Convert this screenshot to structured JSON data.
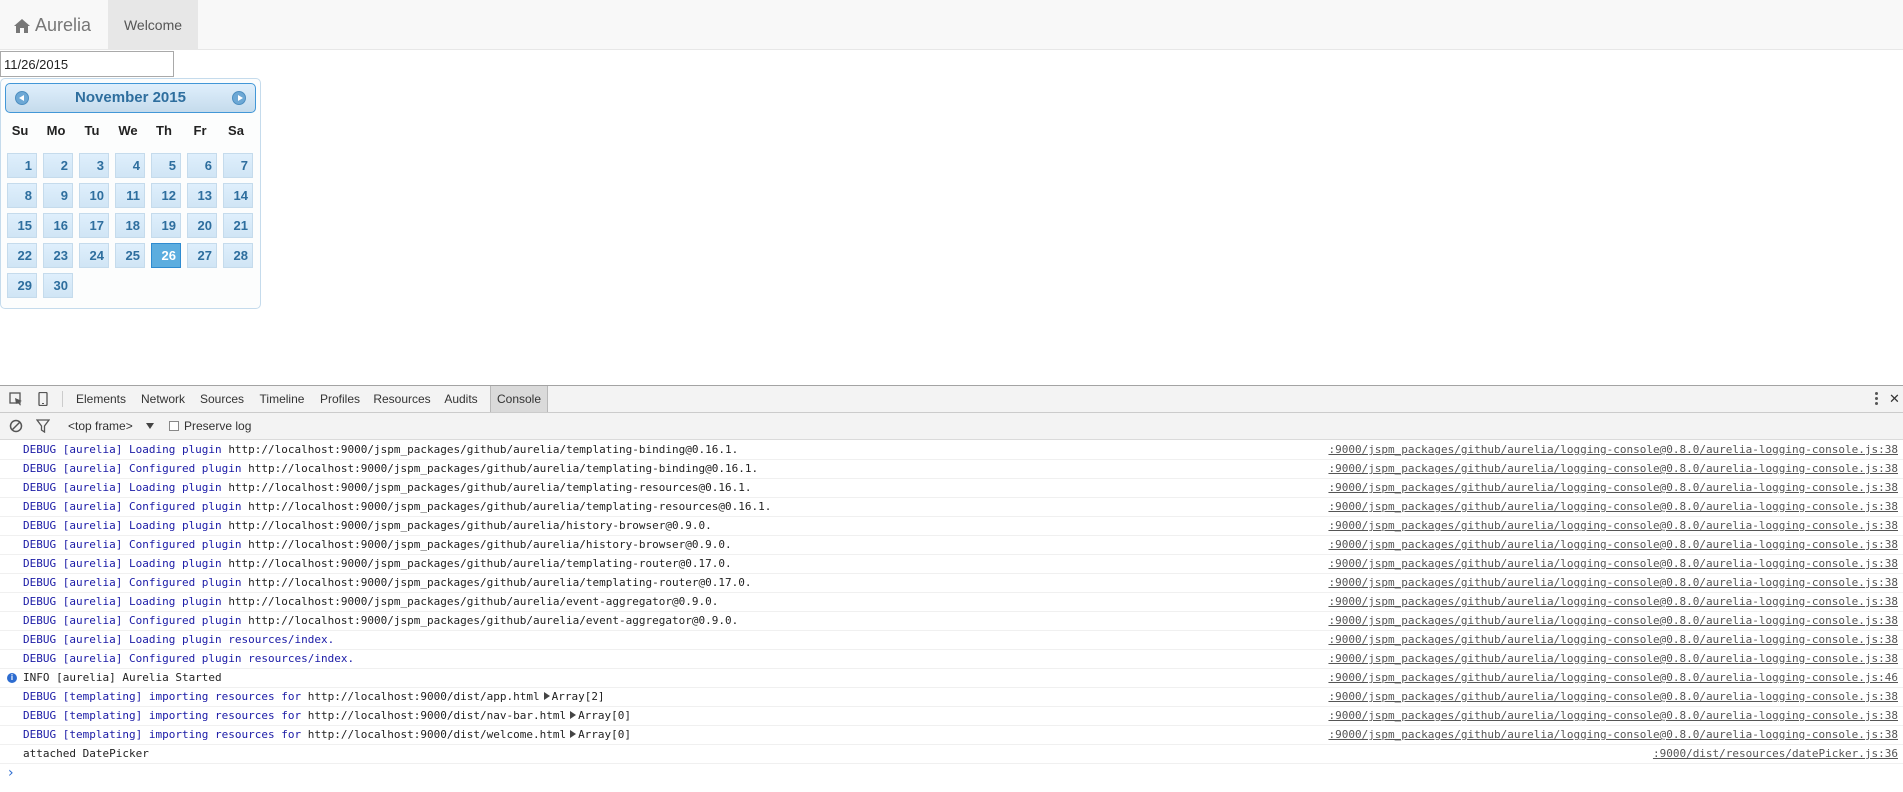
{
  "navbar": {
    "brand": "Aurelia",
    "welcome": "Welcome"
  },
  "date_input": {
    "value": "11/26/2015"
  },
  "datepicker": {
    "title": "November 2015",
    "weekdays": [
      "Su",
      "Mo",
      "Tu",
      "We",
      "Th",
      "Fr",
      "Sa"
    ],
    "days": [
      "1",
      "2",
      "3",
      "4",
      "5",
      "6",
      "7",
      "8",
      "9",
      "10",
      "11",
      "12",
      "13",
      "14",
      "15",
      "16",
      "17",
      "18",
      "19",
      "20",
      "21",
      "22",
      "23",
      "24",
      "25",
      "26",
      "27",
      "28",
      "29",
      "30"
    ],
    "selected_day": "26",
    "start_weekday_index": 0
  },
  "devtools": {
    "tabs": [
      "Elements",
      "Network",
      "Sources",
      "Timeline",
      "Profiles",
      "Resources",
      "Audits",
      "Console"
    ],
    "selected_tab": "Console",
    "frame": "<top frame>",
    "preserve_log_label": "Preserve log"
  },
  "console": {
    "messages": [
      {
        "level": "debug",
        "prefix": "DEBUG [aurelia] Loading plugin ",
        "url": "http://localhost:9000/jspm_packages/github/aurelia/templating-binding@0.16.1.",
        "suffix": "",
        "source": ":9000/jspm_packages/github/aurelia/logging-console@0.8.0/aurelia-logging-console.js:38"
      },
      {
        "level": "debug",
        "prefix": "DEBUG [aurelia] Configured plugin ",
        "url": "http://localhost:9000/jspm_packages/github/aurelia/templating-binding@0.16.1.",
        "suffix": "",
        "source": ":9000/jspm_packages/github/aurelia/logging-console@0.8.0/aurelia-logging-console.js:38"
      },
      {
        "level": "debug",
        "prefix": "DEBUG [aurelia] Loading plugin ",
        "url": "http://localhost:9000/jspm_packages/github/aurelia/templating-resources@0.16.1.",
        "suffix": "",
        "source": ":9000/jspm_packages/github/aurelia/logging-console@0.8.0/aurelia-logging-console.js:38"
      },
      {
        "level": "debug",
        "prefix": "DEBUG [aurelia] Configured plugin ",
        "url": "http://localhost:9000/jspm_packages/github/aurelia/templating-resources@0.16.1.",
        "suffix": "",
        "source": ":9000/jspm_packages/github/aurelia/logging-console@0.8.0/aurelia-logging-console.js:38"
      },
      {
        "level": "debug",
        "prefix": "DEBUG [aurelia] Loading plugin ",
        "url": "http://localhost:9000/jspm_packages/github/aurelia/history-browser@0.9.0.",
        "suffix": "",
        "source": ":9000/jspm_packages/github/aurelia/logging-console@0.8.0/aurelia-logging-console.js:38"
      },
      {
        "level": "debug",
        "prefix": "DEBUG [aurelia] Configured plugin ",
        "url": "http://localhost:9000/jspm_packages/github/aurelia/history-browser@0.9.0.",
        "suffix": "",
        "source": ":9000/jspm_packages/github/aurelia/logging-console@0.8.0/aurelia-logging-console.js:38"
      },
      {
        "level": "debug",
        "prefix": "DEBUG [aurelia] Loading plugin ",
        "url": "http://localhost:9000/jspm_packages/github/aurelia/templating-router@0.17.0.",
        "suffix": "",
        "source": ":9000/jspm_packages/github/aurelia/logging-console@0.8.0/aurelia-logging-console.js:38"
      },
      {
        "level": "debug",
        "prefix": "DEBUG [aurelia] Configured plugin ",
        "url": "http://localhost:9000/jspm_packages/github/aurelia/templating-router@0.17.0.",
        "suffix": "",
        "source": ":9000/jspm_packages/github/aurelia/logging-console@0.8.0/aurelia-logging-console.js:38"
      },
      {
        "level": "debug",
        "prefix": "DEBUG [aurelia] Loading plugin ",
        "url": "http://localhost:9000/jspm_packages/github/aurelia/event-aggregator@0.9.0.",
        "suffix": "",
        "source": ":9000/jspm_packages/github/aurelia/logging-console@0.8.0/aurelia-logging-console.js:38"
      },
      {
        "level": "debug",
        "prefix": "DEBUG [aurelia] Configured plugin ",
        "url": "http://localhost:9000/jspm_packages/github/aurelia/event-aggregator@0.9.0.",
        "suffix": "",
        "source": ":9000/jspm_packages/github/aurelia/logging-console@0.8.0/aurelia-logging-console.js:38"
      },
      {
        "level": "debug",
        "prefix": "DEBUG [aurelia] Loading plugin resources/index.",
        "url": "",
        "suffix": "",
        "source": ":9000/jspm_packages/github/aurelia/logging-console@0.8.0/aurelia-logging-console.js:38"
      },
      {
        "level": "debug",
        "prefix": "DEBUG [aurelia] Configured plugin resources/index.",
        "url": "",
        "suffix": "",
        "source": ":9000/jspm_packages/github/aurelia/logging-console@0.8.0/aurelia-logging-console.js:38"
      },
      {
        "level": "info",
        "prefix": "INFO [aurelia] Aurelia Started",
        "url": "",
        "suffix": "",
        "source": ":9000/jspm_packages/github/aurelia/logging-console@0.8.0/aurelia-logging-console.js:46"
      },
      {
        "level": "debug",
        "prefix": "DEBUG [templating] importing resources for ",
        "url": "http://localhost:9000/dist/app.html",
        "suffix": "Array[2]",
        "source": ":9000/jspm_packages/github/aurelia/logging-console@0.8.0/aurelia-logging-console.js:38"
      },
      {
        "level": "debug",
        "prefix": "DEBUG [templating] importing resources for ",
        "url": "http://localhost:9000/dist/nav-bar.html",
        "suffix": "Array[0]",
        "source": ":9000/jspm_packages/github/aurelia/logging-console@0.8.0/aurelia-logging-console.js:38"
      },
      {
        "level": "debug",
        "prefix": "DEBUG [templating] importing resources for ",
        "url": "http://localhost:9000/dist/welcome.html",
        "suffix": "Array[0]",
        "source": ":9000/jspm_packages/github/aurelia/logging-console@0.8.0/aurelia-logging-console.js:38"
      },
      {
        "level": "plain",
        "prefix": "attached DatePicker",
        "url": "",
        "suffix": "",
        "source": ":9000/dist/resources/datePicker.js:36"
      }
    ],
    "prompt": "›"
  },
  "colors": {
    "debug_text": "#1a1aa6",
    "info_icon": "#2d6cd0",
    "selected_day": "#5caddf",
    "datepicker_text": "#2e6e9e"
  }
}
